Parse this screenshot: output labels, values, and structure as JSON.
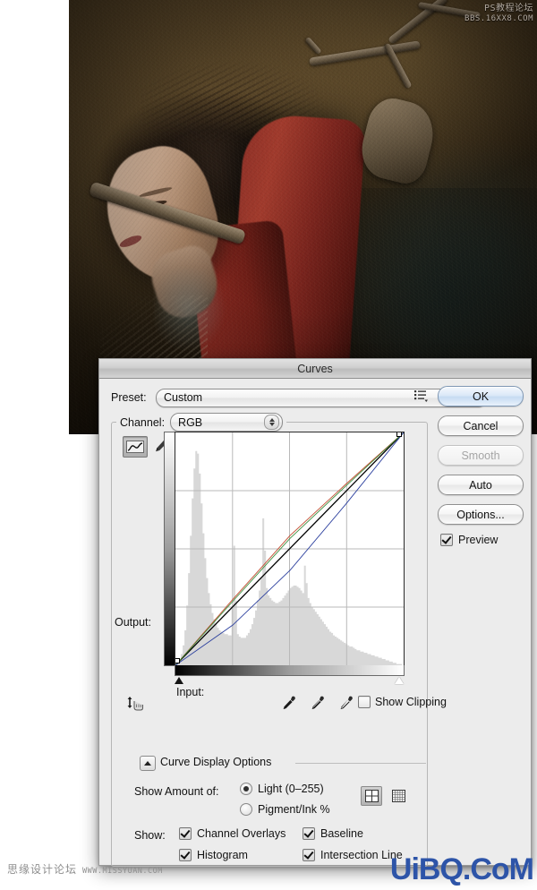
{
  "photo": {
    "alt": "dark fantasy portrait of woman with red drape and branch",
    "watermark_line1": "PS教程论坛",
    "watermark_line2": "BBS.16XX8.COM"
  },
  "dialog": {
    "title": "Curves",
    "preset": {
      "label": "Preset:",
      "value": "Custom",
      "menu_icon": "preset-menu-icon"
    },
    "channel": {
      "label": "Channel:",
      "value": "RGB"
    },
    "tools": {
      "curve_tool_icon": "curve-tool-icon",
      "pencil_tool_icon": "pencil-tool-icon",
      "cursor_tool_icon": "curve-point-cursor-icon",
      "black_eyedropper": "black-point-eyedropper-icon",
      "gray_eyedropper": "gray-point-eyedropper-icon",
      "white_eyedropper": "white-point-eyedropper-icon"
    },
    "graph": {
      "output_label": "Output:",
      "input_label": "Input:",
      "output_value": "",
      "input_value": ""
    },
    "show_clipping": {
      "label": "Show Clipping",
      "checked": false
    },
    "curve_display_options": {
      "title": "Curve Display Options",
      "expanded": true,
      "show_amount_label": "Show Amount of:",
      "options": [
        {
          "label": "Light  (0–255)",
          "selected": true
        },
        {
          "label": "Pigment/Ink %",
          "selected": false
        }
      ],
      "grid_simple_icon": "grid-quarters-icon",
      "grid_detailed_icon": "grid-tenths-icon",
      "show_label": "Show:",
      "checkboxes": [
        {
          "label": "Channel Overlays",
          "checked": true
        },
        {
          "label": "Histogram",
          "checked": true
        },
        {
          "label": "Baseline",
          "checked": true
        },
        {
          "label": "Intersection Line",
          "checked": true
        }
      ]
    },
    "buttons": [
      {
        "label": "OK",
        "style": "primary",
        "enabled": true
      },
      {
        "label": "Cancel",
        "style": "normal",
        "enabled": true
      },
      {
        "label": "Smooth",
        "style": "disabled",
        "enabled": false
      },
      {
        "label": "Auto",
        "style": "normal",
        "enabled": true
      },
      {
        "label": "Options...",
        "style": "normal",
        "enabled": true
      }
    ],
    "preview": {
      "label": "Preview",
      "checked": true
    }
  },
  "watermarks": {
    "bottom_left_cn": "思缘设计论坛",
    "bottom_left_url": "WWW.MISSYUAN.COM",
    "bottom_right": "UiBQ.CoM"
  },
  "chart_data": {
    "type": "line",
    "title": "Curves",
    "xlabel": "Input",
    "ylabel": "Output",
    "xlim": [
      0,
      255
    ],
    "ylim": [
      0,
      255
    ],
    "grid": true,
    "grid_divisions": 4,
    "series": [
      {
        "name": "RGB",
        "color": "#000000",
        "points": [
          [
            0,
            0
          ],
          [
            255,
            255
          ]
        ],
        "control_points": [
          [
            0,
            0
          ],
          [
            255,
            255
          ]
        ]
      },
      {
        "name": "Red",
        "color": "#c24a2e",
        "points": [
          [
            0,
            0
          ],
          [
            64,
            72
          ],
          [
            128,
            142
          ],
          [
            190,
            198
          ],
          [
            255,
            255
          ]
        ]
      },
      {
        "name": "Green",
        "color": "#3f8f3f",
        "points": [
          [
            0,
            0
          ],
          [
            64,
            70
          ],
          [
            128,
            139
          ],
          [
            190,
            196
          ],
          [
            255,
            255
          ]
        ]
      },
      {
        "name": "Blue",
        "color": "#2b3f9e",
        "points": [
          [
            0,
            0
          ],
          [
            64,
            44
          ],
          [
            128,
            104
          ],
          [
            190,
            176
          ],
          [
            255,
            255
          ]
        ]
      }
    ],
    "histogram": {
      "color": "#d8d8d8",
      "bins": [
        2,
        3,
        5,
        9,
        16,
        28,
        48,
        74,
        104,
        134,
        158,
        172,
        170,
        154,
        130,
        106,
        86,
        70,
        58,
        49,
        42,
        37,
        33,
        30,
        28,
        27,
        26,
        25,
        25,
        24,
        24,
        46,
        96,
        52,
        25,
        23,
        22,
        22,
        22,
        24,
        26,
        29,
        33,
        38,
        44,
        52,
        60,
        70,
        118,
        92,
        62,
        56,
        54,
        52,
        51,
        50,
        50,
        51,
        52,
        54,
        56,
        58,
        60,
        62,
        63,
        64,
        64,
        63,
        62,
        60,
        58,
        80,
        66,
        54,
        50,
        47,
        45,
        43,
        41,
        39,
        37,
        35,
        33,
        31,
        29,
        27,
        26,
        24,
        23,
        22,
        21,
        20,
        19,
        18,
        17,
        16,
        15,
        15,
        14,
        13,
        12,
        12,
        11,
        11,
        10,
        10,
        9,
        9,
        8,
        8,
        7,
        7,
        6,
        6,
        5,
        5,
        4,
        4,
        3,
        3,
        2,
        2,
        1,
        1,
        1,
        0
      ]
    }
  }
}
